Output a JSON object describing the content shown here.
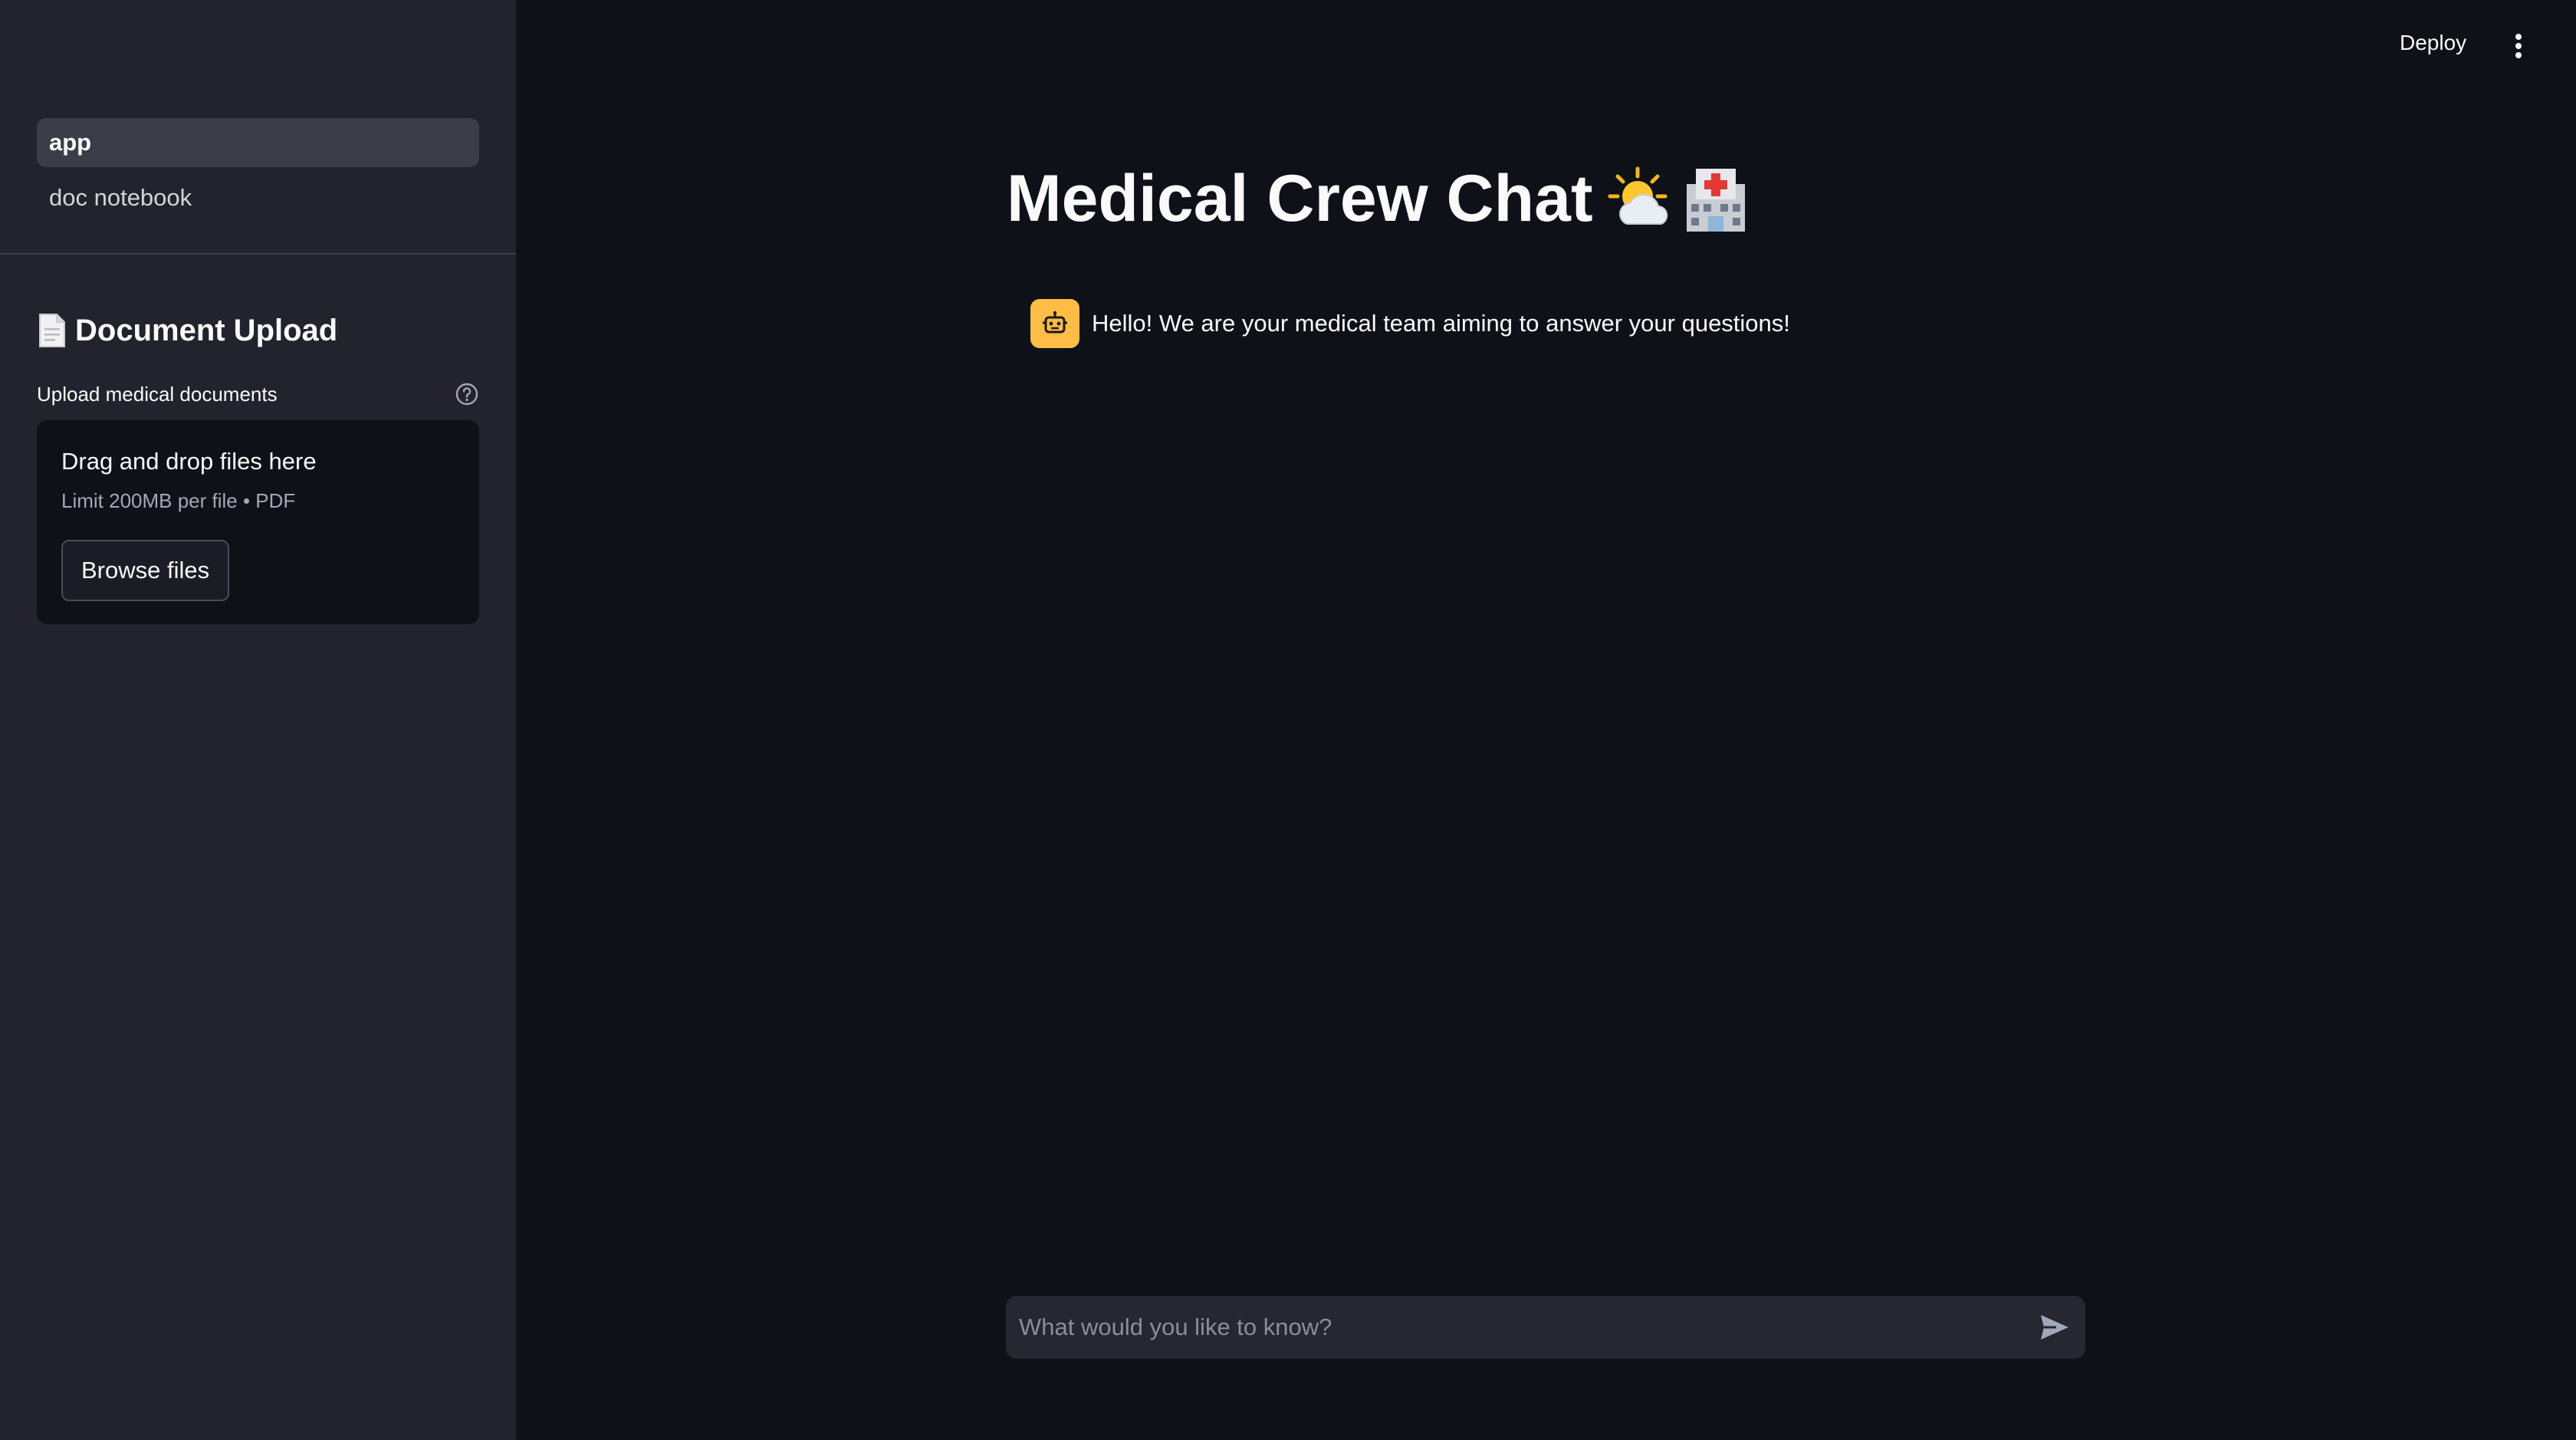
{
  "sidebar": {
    "nav": [
      {
        "label": "app",
        "active": true
      },
      {
        "label": "doc notebook",
        "active": false
      }
    ],
    "header": {
      "icon": "document-icon",
      "title": "Document Upload"
    },
    "uploader": {
      "label": "Upload medical documents",
      "help_icon": "help-circle-icon",
      "drop_title": "Drag and drop files here",
      "drop_subtitle": "Limit 200MB per file • PDF",
      "browse_label": "Browse files"
    }
  },
  "topbar": {
    "deploy_label": "Deploy",
    "menu_icon": "kebab-menu-icon"
  },
  "main": {
    "title": "Medical Crew Chat",
    "title_emojis": [
      "sun-behind-cloud-icon",
      "hospital-icon"
    ],
    "messages": [
      {
        "avatar_icon": "robot-icon",
        "text": "Hello! We are your medical team aiming to answer your questions!"
      }
    ],
    "chat_input": {
      "placeholder": "What would you like to know?",
      "send_icon": "send-icon"
    }
  },
  "colors": {
    "background": "#0e1117",
    "sidebar": "#22232d",
    "avatar": "#ffbd45",
    "input": "#262730"
  }
}
